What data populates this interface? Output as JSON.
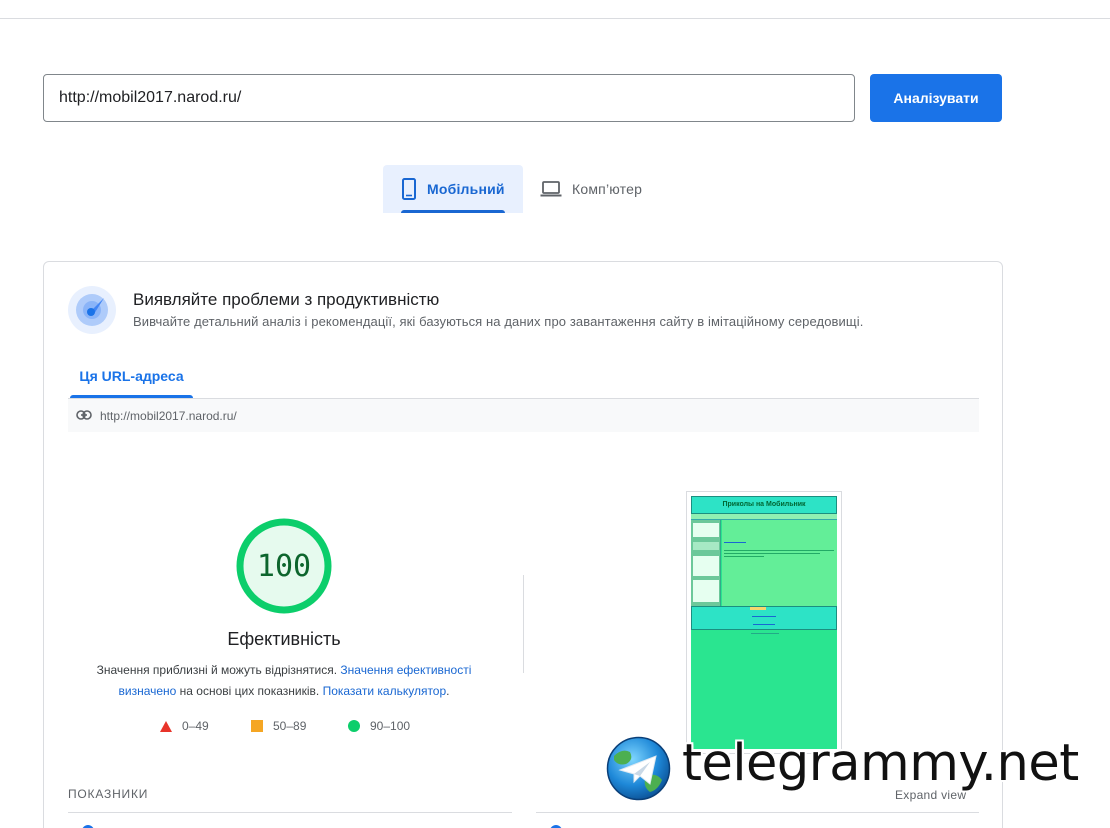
{
  "search": {
    "url_value": "http://mobil2017.narod.ru/",
    "analyze_label": "Аналізувати"
  },
  "device_tabs": [
    {
      "label": "Мобільний",
      "icon": "mobile-phone-icon",
      "active": true
    },
    {
      "label": "Комп’ютер",
      "icon": "laptop-icon",
      "active": false
    }
  ],
  "card": {
    "icon": "speed-dial-icon",
    "title": "Виявляйте проблеми з продуктивністю",
    "subtitle": "Вивчайте детальний аналіз і рекомендації, які базуються на даних про завантаження сайту в імітаційному середовищі.",
    "url_tab": "Ця URL-адреса",
    "tested_url": "http://mobil2017.narod.ru/"
  },
  "score": {
    "value": "100",
    "fraction": 1.0,
    "label": "Ефективність",
    "desc_part1": "Значення приблизні й можуть відрізнятися. ",
    "desc_link1": "Значення ефективності визначено",
    "desc_part2": " на основі цих показників. ",
    "desc_link2": "Показати калькулятор",
    "desc_part3": ".",
    "color_pass": "#0cce6b",
    "color_average": "#ffa400",
    "color_fail": "#ff4e42"
  },
  "legend": [
    {
      "range": "0–49",
      "shape": "triangle",
      "color": "#e8342a"
    },
    {
      "range": "50–89",
      "shape": "square",
      "color": "#f5a623"
    },
    {
      "range": "90–100",
      "shape": "circle",
      "color": "#0cce6b"
    }
  ],
  "screenshot": {
    "site_title": "Приколы на Мобильник"
  },
  "metrics": {
    "section_label": "ПОКАЗНИКИ",
    "expand_label": "Expand view"
  },
  "watermark": {
    "text": "telegrammy.net"
  }
}
